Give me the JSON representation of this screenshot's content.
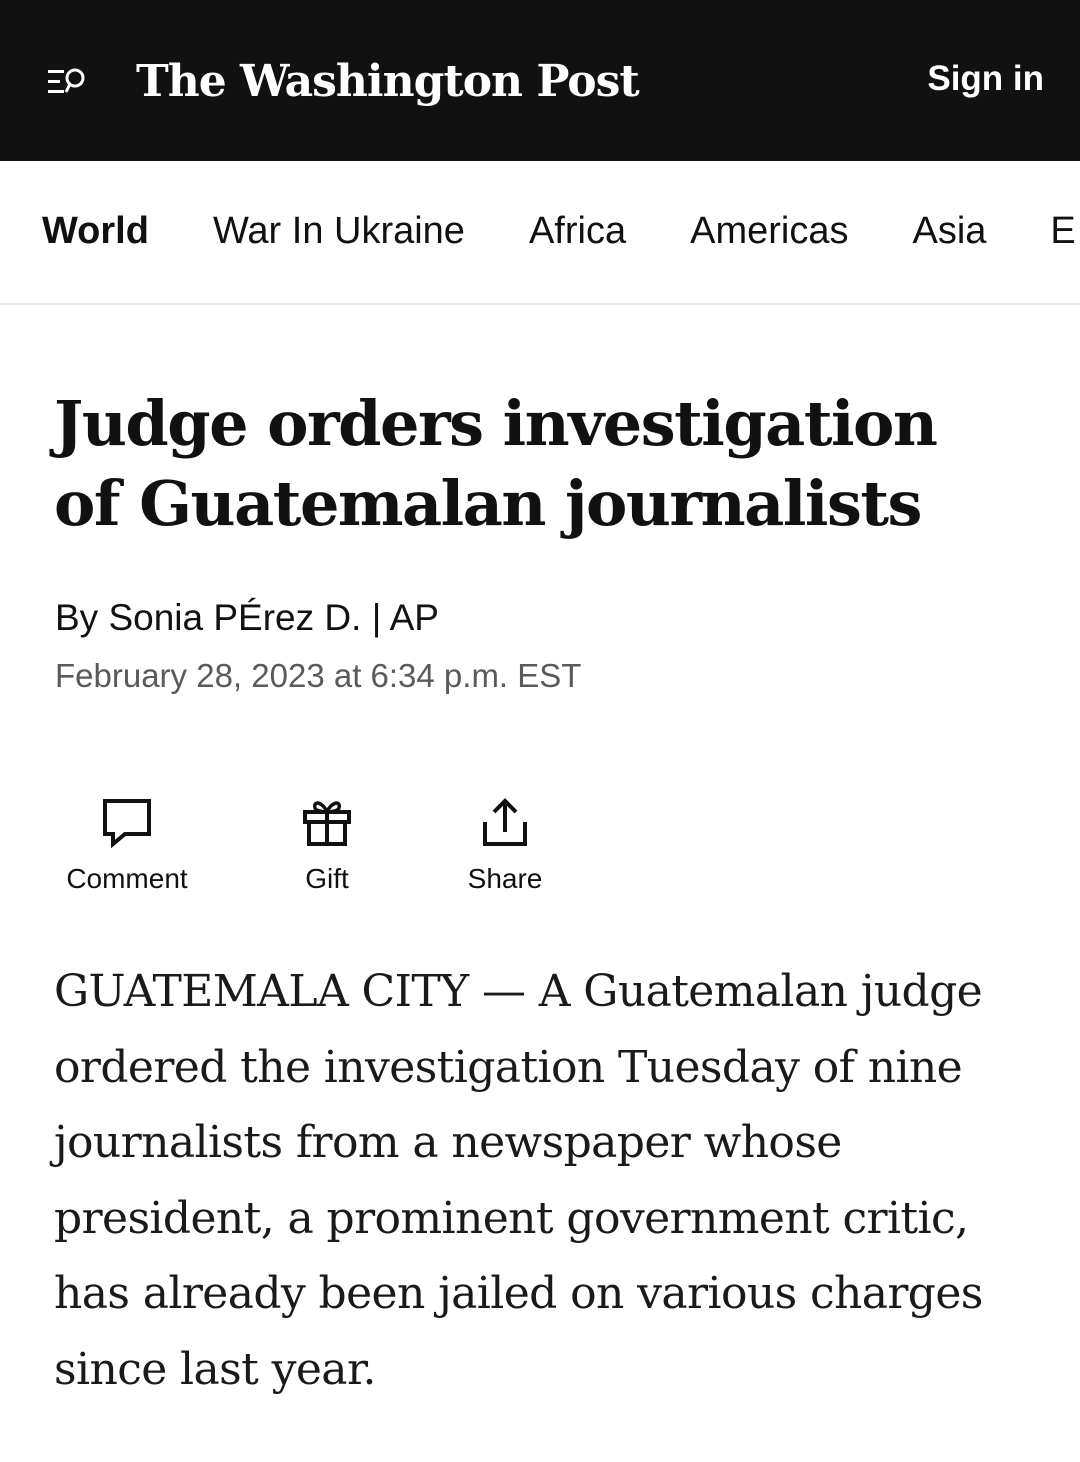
{
  "header": {
    "logo": "The Washington Post",
    "sign_in": "Sign in",
    "menu_icon": "menu-search-icon"
  },
  "section_nav": {
    "items": [
      {
        "label": "World",
        "active": true
      },
      {
        "label": "War In Ukraine",
        "active": false
      },
      {
        "label": "Africa",
        "active": false
      },
      {
        "label": "Americas",
        "active": false
      },
      {
        "label": "Asia",
        "active": false
      },
      {
        "label": "E",
        "active": false
      }
    ]
  },
  "article": {
    "headline": "Judge orders investigation of Guatemalan journalists",
    "byline": {
      "prefix": "By ",
      "author": "Sonia PÉrez D.",
      "separator": " | ",
      "source": "AP"
    },
    "date": "February 28, 2023 at 6:34 p.m. EST",
    "body": "GUATEMALA CITY — A Guatemalan judge ordered the investigation Tuesday of nine journalists from a newspaper whose president, a prominent government critic, has already been jailed on various charges since last year."
  },
  "actions": {
    "comment": {
      "label": "Comment",
      "icon": "comment-icon"
    },
    "gift": {
      "label": "Gift",
      "icon": "gift-icon"
    },
    "share": {
      "label": "Share",
      "icon": "share-icon"
    }
  }
}
